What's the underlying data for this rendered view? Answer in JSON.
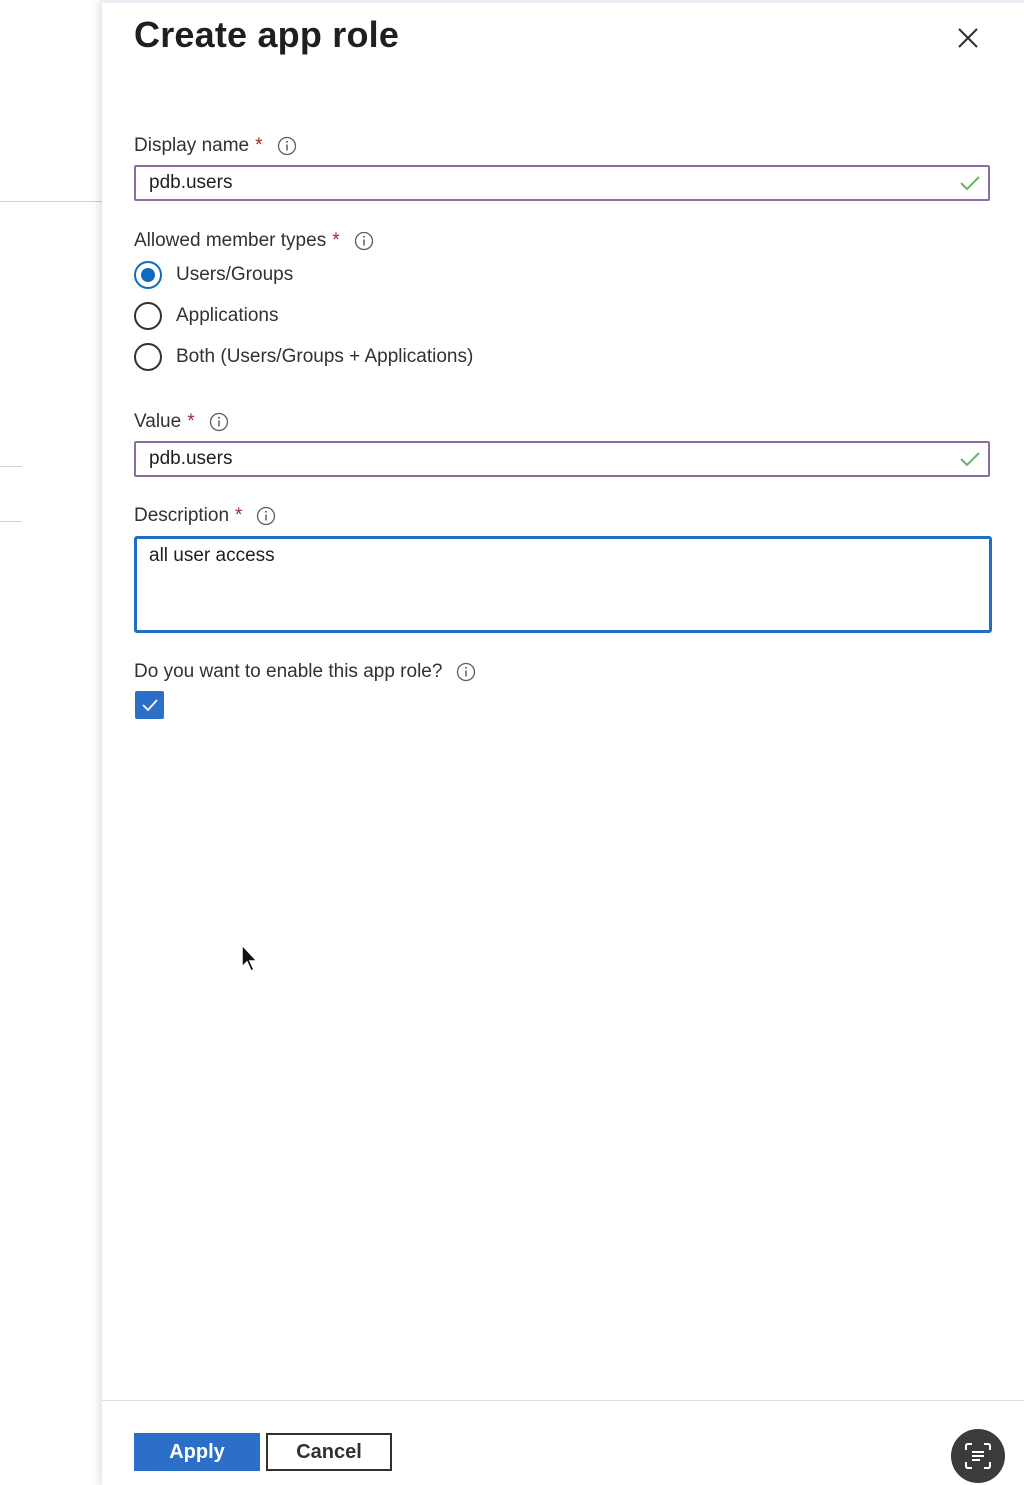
{
  "panel": {
    "title": "Create app role"
  },
  "form": {
    "display_name": {
      "label": "Display name",
      "required_mark": "*",
      "value": "pdb.users"
    },
    "member_types": {
      "label": "Allowed member types",
      "required_mark": "*",
      "options": [
        {
          "label": "Users/Groups",
          "checked": true
        },
        {
          "label": "Applications",
          "checked": false
        },
        {
          "label": "Both (Users/Groups + Applications)",
          "checked": false
        }
      ]
    },
    "value_field": {
      "label": "Value",
      "required_mark": "*",
      "value": "pdb.users"
    },
    "description": {
      "label": "Description",
      "required_mark": "*",
      "value": "all user access"
    },
    "enable": {
      "label": "Do you want to enable this app role?",
      "checked": true
    }
  },
  "footer": {
    "apply_label": "Apply",
    "cancel_label": "Cancel"
  },
  "colors": {
    "accent": "#2b6fc8",
    "required": "#a4262c",
    "valid_check": "#6bb36b",
    "input_border": "#8a6fa0",
    "focus_border": "#1e6fc2"
  },
  "icons": {
    "close": "close-icon",
    "info": "info-icon",
    "valid": "checkmark-icon",
    "checkbox": "checkmark-icon",
    "fab": "text-scan-icon",
    "cursor": "mouse-pointer-icon"
  }
}
